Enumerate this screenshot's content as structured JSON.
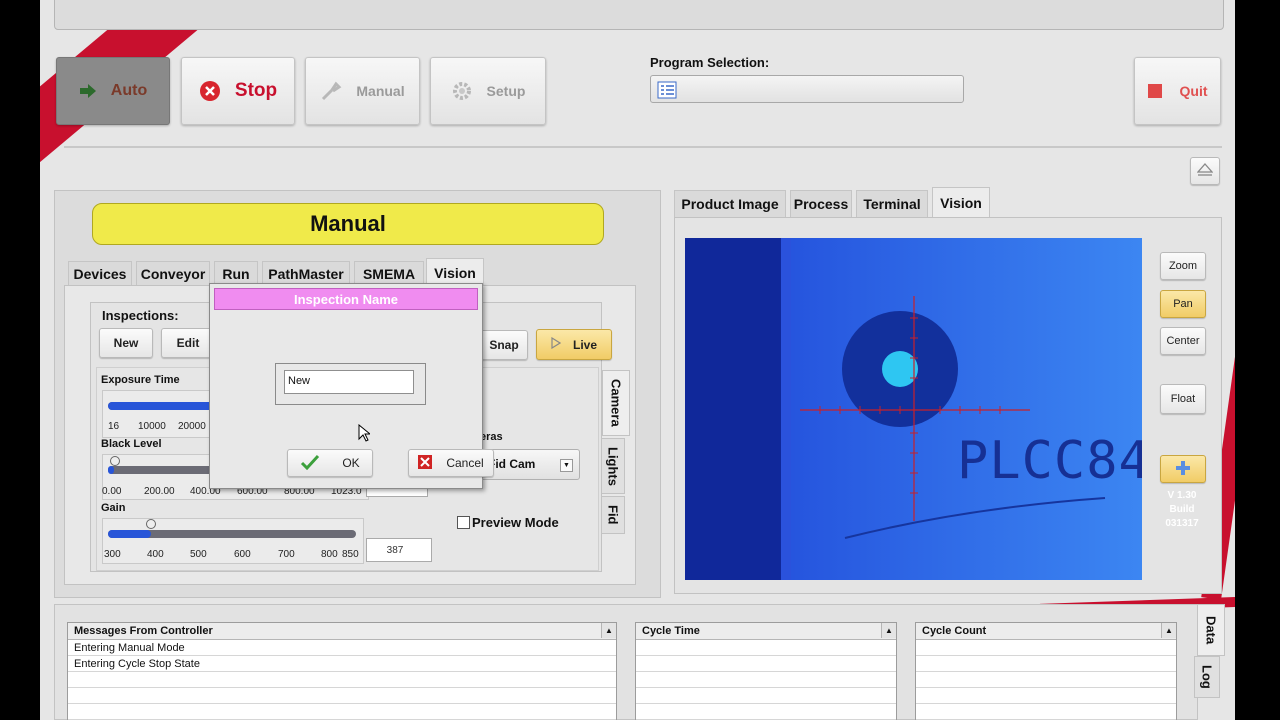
{
  "toolbar": {
    "auto_label": "Auto",
    "stop_label": "Stop",
    "manual_label": "Manual",
    "setup_label": "Setup",
    "quit_label": "Quit",
    "program_selection_label": "Program Selection:",
    "program_selection_value": ""
  },
  "left_panel": {
    "mode_title": "Manual",
    "tabs": [
      "Devices",
      "Conveyor",
      "Run",
      "PathMaster",
      "SMEMA",
      "Vision"
    ],
    "active_tab": "Vision",
    "inspections_label": "Inspections:",
    "new_button": "New",
    "edit_button": "Edit",
    "snap_button": "Snap",
    "live_button": "Live",
    "exposure": {
      "label": "Exposure Time",
      "ticks": [
        "16",
        "10000",
        "20000"
      ]
    },
    "black_level": {
      "label": "Black Level",
      "ticks": [
        "0.00",
        "200.00",
        "400.00",
        "600.00",
        "800.00",
        "1023.0"
      ]
    },
    "gain": {
      "label": "Gain",
      "ticks": [
        "300",
        "400",
        "500",
        "600",
        "700",
        "800",
        "850"
      ],
      "value": "387"
    },
    "cameras_label": "eras",
    "camera_select": "Fid Cam",
    "preview_mode_label": "Preview Mode",
    "side_tabs": [
      "Camera",
      "Lights",
      "Fid"
    ]
  },
  "dialog": {
    "title": "Inspection Name",
    "input_value": "New",
    "ok_label": "OK",
    "cancel_label": "Cancel"
  },
  "right_panel": {
    "tabs": [
      "Product Image",
      "Process",
      "Terminal",
      "Vision"
    ],
    "active_tab": "Vision",
    "image_text": "PLCC84",
    "zoom_label": "Zoom",
    "pan_label": "Pan",
    "center_label": "Center",
    "float_label": "Float",
    "version_line1": "V 1.30",
    "version_line2": "Build",
    "version_line3": "031317"
  },
  "bottom": {
    "messages_header": "Messages From Controller",
    "messages": [
      "Entering Manual Mode",
      "Entering Cycle Stop State"
    ],
    "cycle_time_header": "Cycle Time",
    "cycle_count_header": "Cycle Count",
    "side_tabs": [
      "Data",
      "Log"
    ]
  },
  "colors": {
    "accent_red": "#c8102e",
    "title_yellow": "#f0ea4a",
    "dialog_title_pink": "#f08cf0",
    "camera_blue": "#2b55e0"
  }
}
